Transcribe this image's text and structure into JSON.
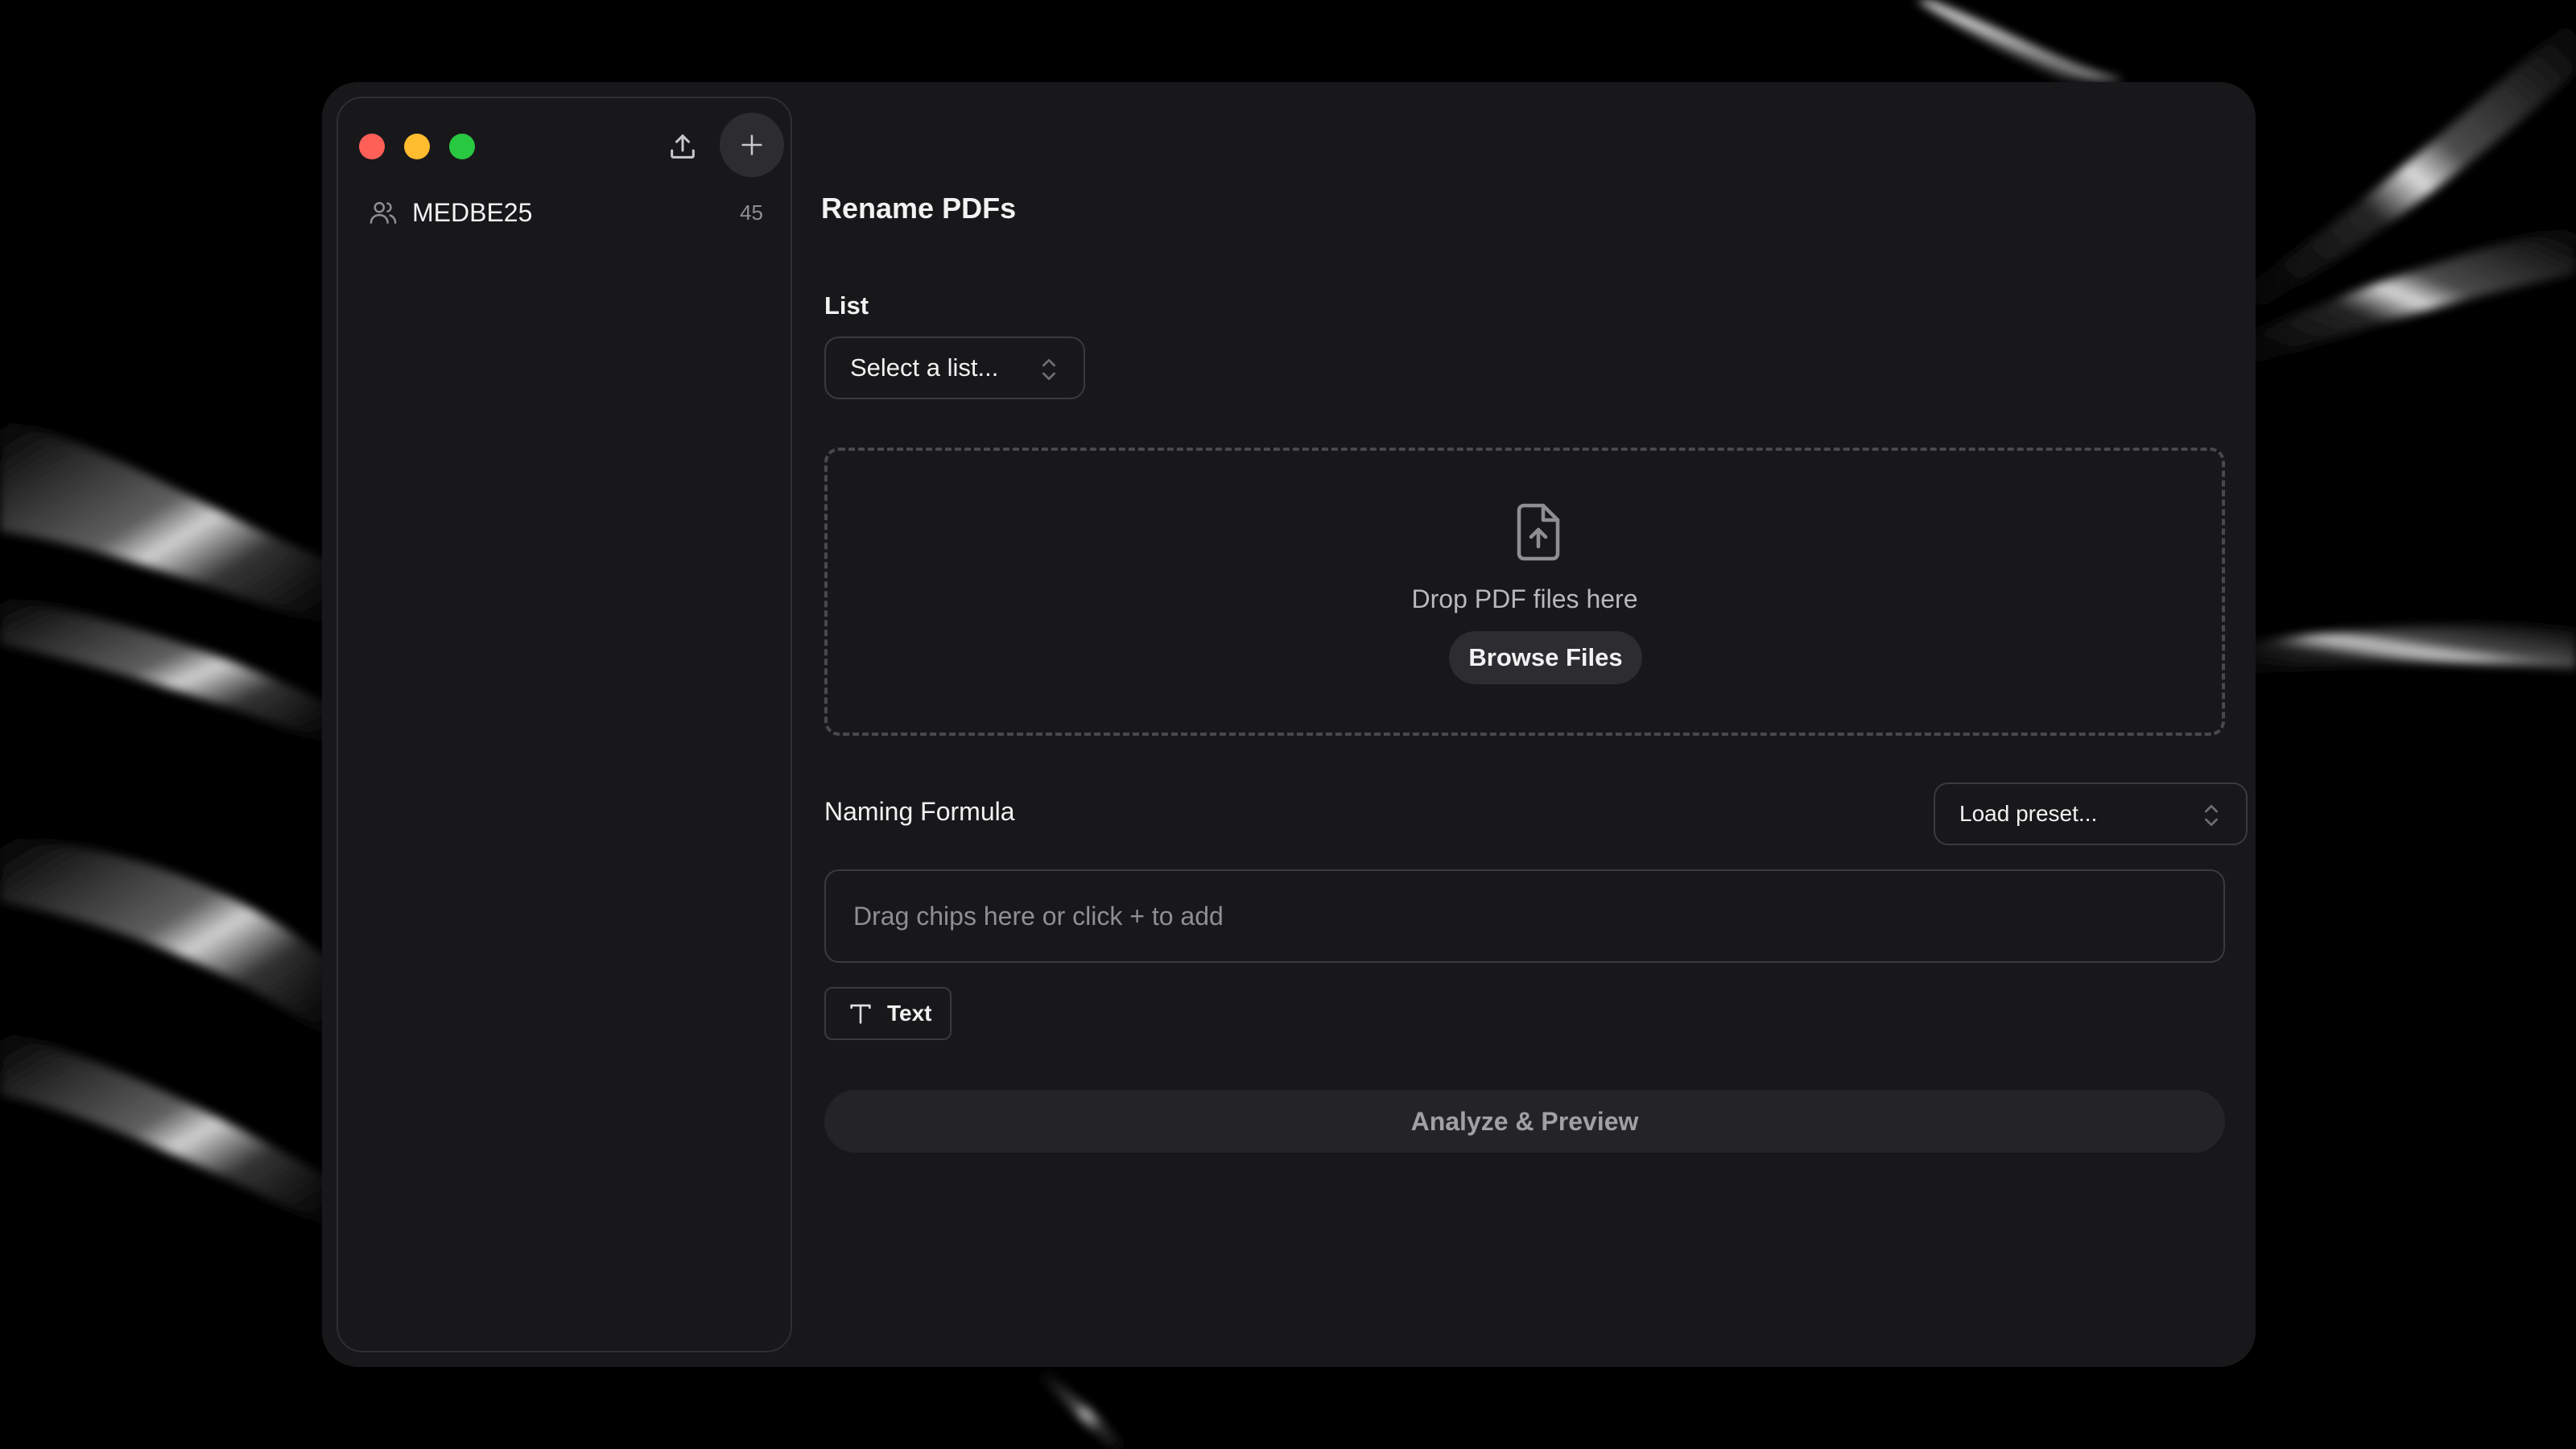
{
  "window": {
    "title": "Rename PDFs"
  },
  "sidebar": {
    "items": [
      {
        "label": "MEDBE25",
        "count": "45",
        "icon": "users-icon"
      }
    ]
  },
  "list_field": {
    "label": "List",
    "placeholder": "Select a list..."
  },
  "dropzone": {
    "text": "Drop PDF files here",
    "browse_label": "Browse Files",
    "icon": "file-upload-icon"
  },
  "naming_formula": {
    "label": "Naming Formula",
    "preset_placeholder": "Load preset...",
    "chips_placeholder": "Drag chips here or click + to add",
    "chip_types": [
      {
        "label": "Text",
        "icon": "text-type-icon"
      }
    ]
  },
  "actions": {
    "analyze_label": "Analyze & Preview"
  },
  "colors": {
    "window_bg": "#18181b",
    "traffic_close": "#fe5f57",
    "traffic_minimize": "#febc2e",
    "traffic_maximize": "#28c840"
  }
}
